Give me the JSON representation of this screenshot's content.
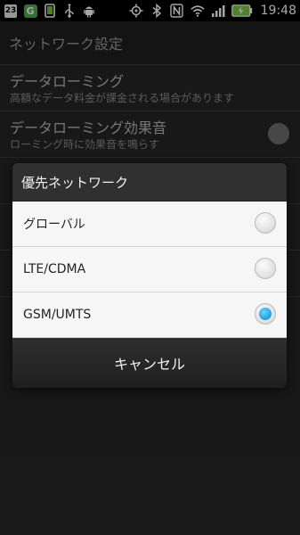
{
  "status_bar": {
    "calendar_day": "23",
    "app_letter": "G",
    "time": "19:48",
    "icons_left": [
      "calendar-icon",
      "app-g-icon",
      "device-icon",
      "usb-icon",
      "android-debug-icon"
    ],
    "icons_right": [
      "gps-icon",
      "bluetooth-icon",
      "nfc-icon",
      "wifi-icon",
      "signal-icon",
      "battery-charging-icon"
    ]
  },
  "page": {
    "title": "ネットワーク設定",
    "rows": [
      {
        "title": "データローミング",
        "subtitle": "高額なデータ料金が課金される場合があります"
      },
      {
        "title": "データローミング効果音",
        "subtitle": "ローミング時に効果音を鳴らす"
      }
    ]
  },
  "dialog": {
    "title": "優先ネットワーク",
    "options": [
      {
        "label": "グローバル",
        "selected": false
      },
      {
        "label": "LTE/CDMA",
        "selected": false
      },
      {
        "label": "GSM/UMTS",
        "selected": true
      }
    ],
    "cancel_label": "キャンセル"
  },
  "colors": {
    "radio_selected": "#2aa7e6",
    "dialog_body": "#f6f6f6",
    "dialog_header": "#303030"
  }
}
